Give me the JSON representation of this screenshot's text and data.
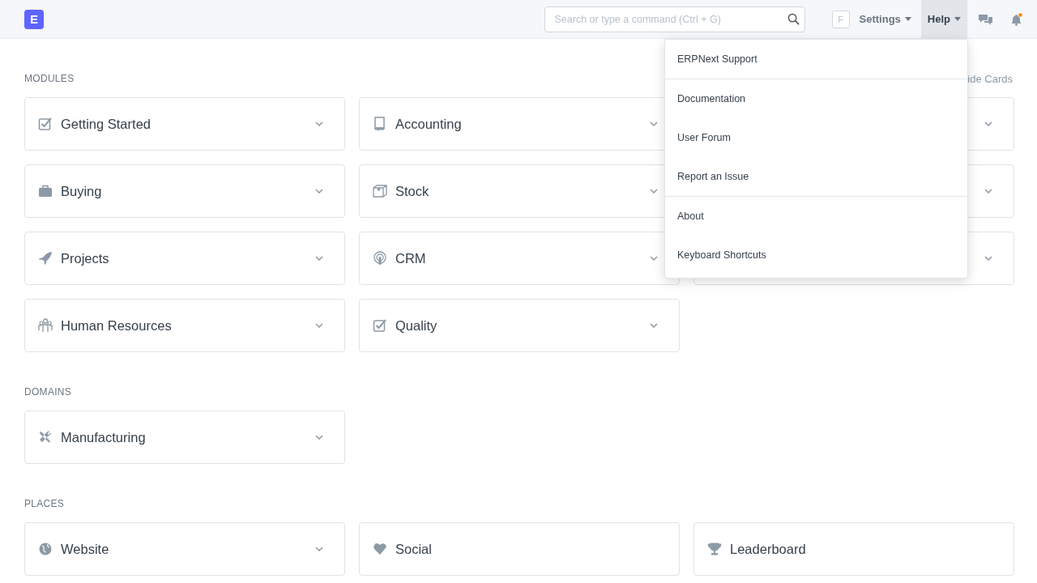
{
  "navbar": {
    "logo": "E",
    "search": {
      "placeholder": "Search or type a command (Ctrl + G)"
    },
    "avatar": "F",
    "menus": [
      {
        "label": "Settings",
        "open": false
      },
      {
        "label": "Help",
        "open": true
      }
    ],
    "notifications": {
      "unread": true
    }
  },
  "help_menu": {
    "groups": [
      [
        "ERPNext Support"
      ],
      [
        "Documentation",
        "User Forum",
        "Report an Issue"
      ],
      [
        "About",
        "Keyboard Shortcuts"
      ]
    ]
  },
  "hide_cards_link": "ide Cards",
  "sections": [
    {
      "title": "MODULES",
      "cards": [
        {
          "label": "Getting Started",
          "expandable": true
        },
        {
          "label": "Accounting",
          "expandable": true
        },
        {
          "expandable": true
        },
        {
          "label": "Buying",
          "expandable": true
        },
        {
          "label": "Stock",
          "expandable": true
        },
        {
          "expandable": true
        },
        {
          "label": "Projects",
          "expandable": true
        },
        {
          "label": "CRM",
          "expandable": true
        },
        {
          "expandable": true
        },
        {
          "label": "Human Resources",
          "expandable": true
        },
        {
          "label": "Quality",
          "expandable": true
        }
      ]
    },
    {
      "title": "DOMAINS",
      "cards": [
        {
          "label": "Manufacturing",
          "expandable": true
        }
      ]
    },
    {
      "title": "PLACES",
      "cards": [
        {
          "label": "Website",
          "expandable": true
        },
        {
          "label": "Social",
          "expandable": false
        },
        {
          "label": "Leaderboard",
          "expandable": false
        }
      ]
    }
  ]
}
